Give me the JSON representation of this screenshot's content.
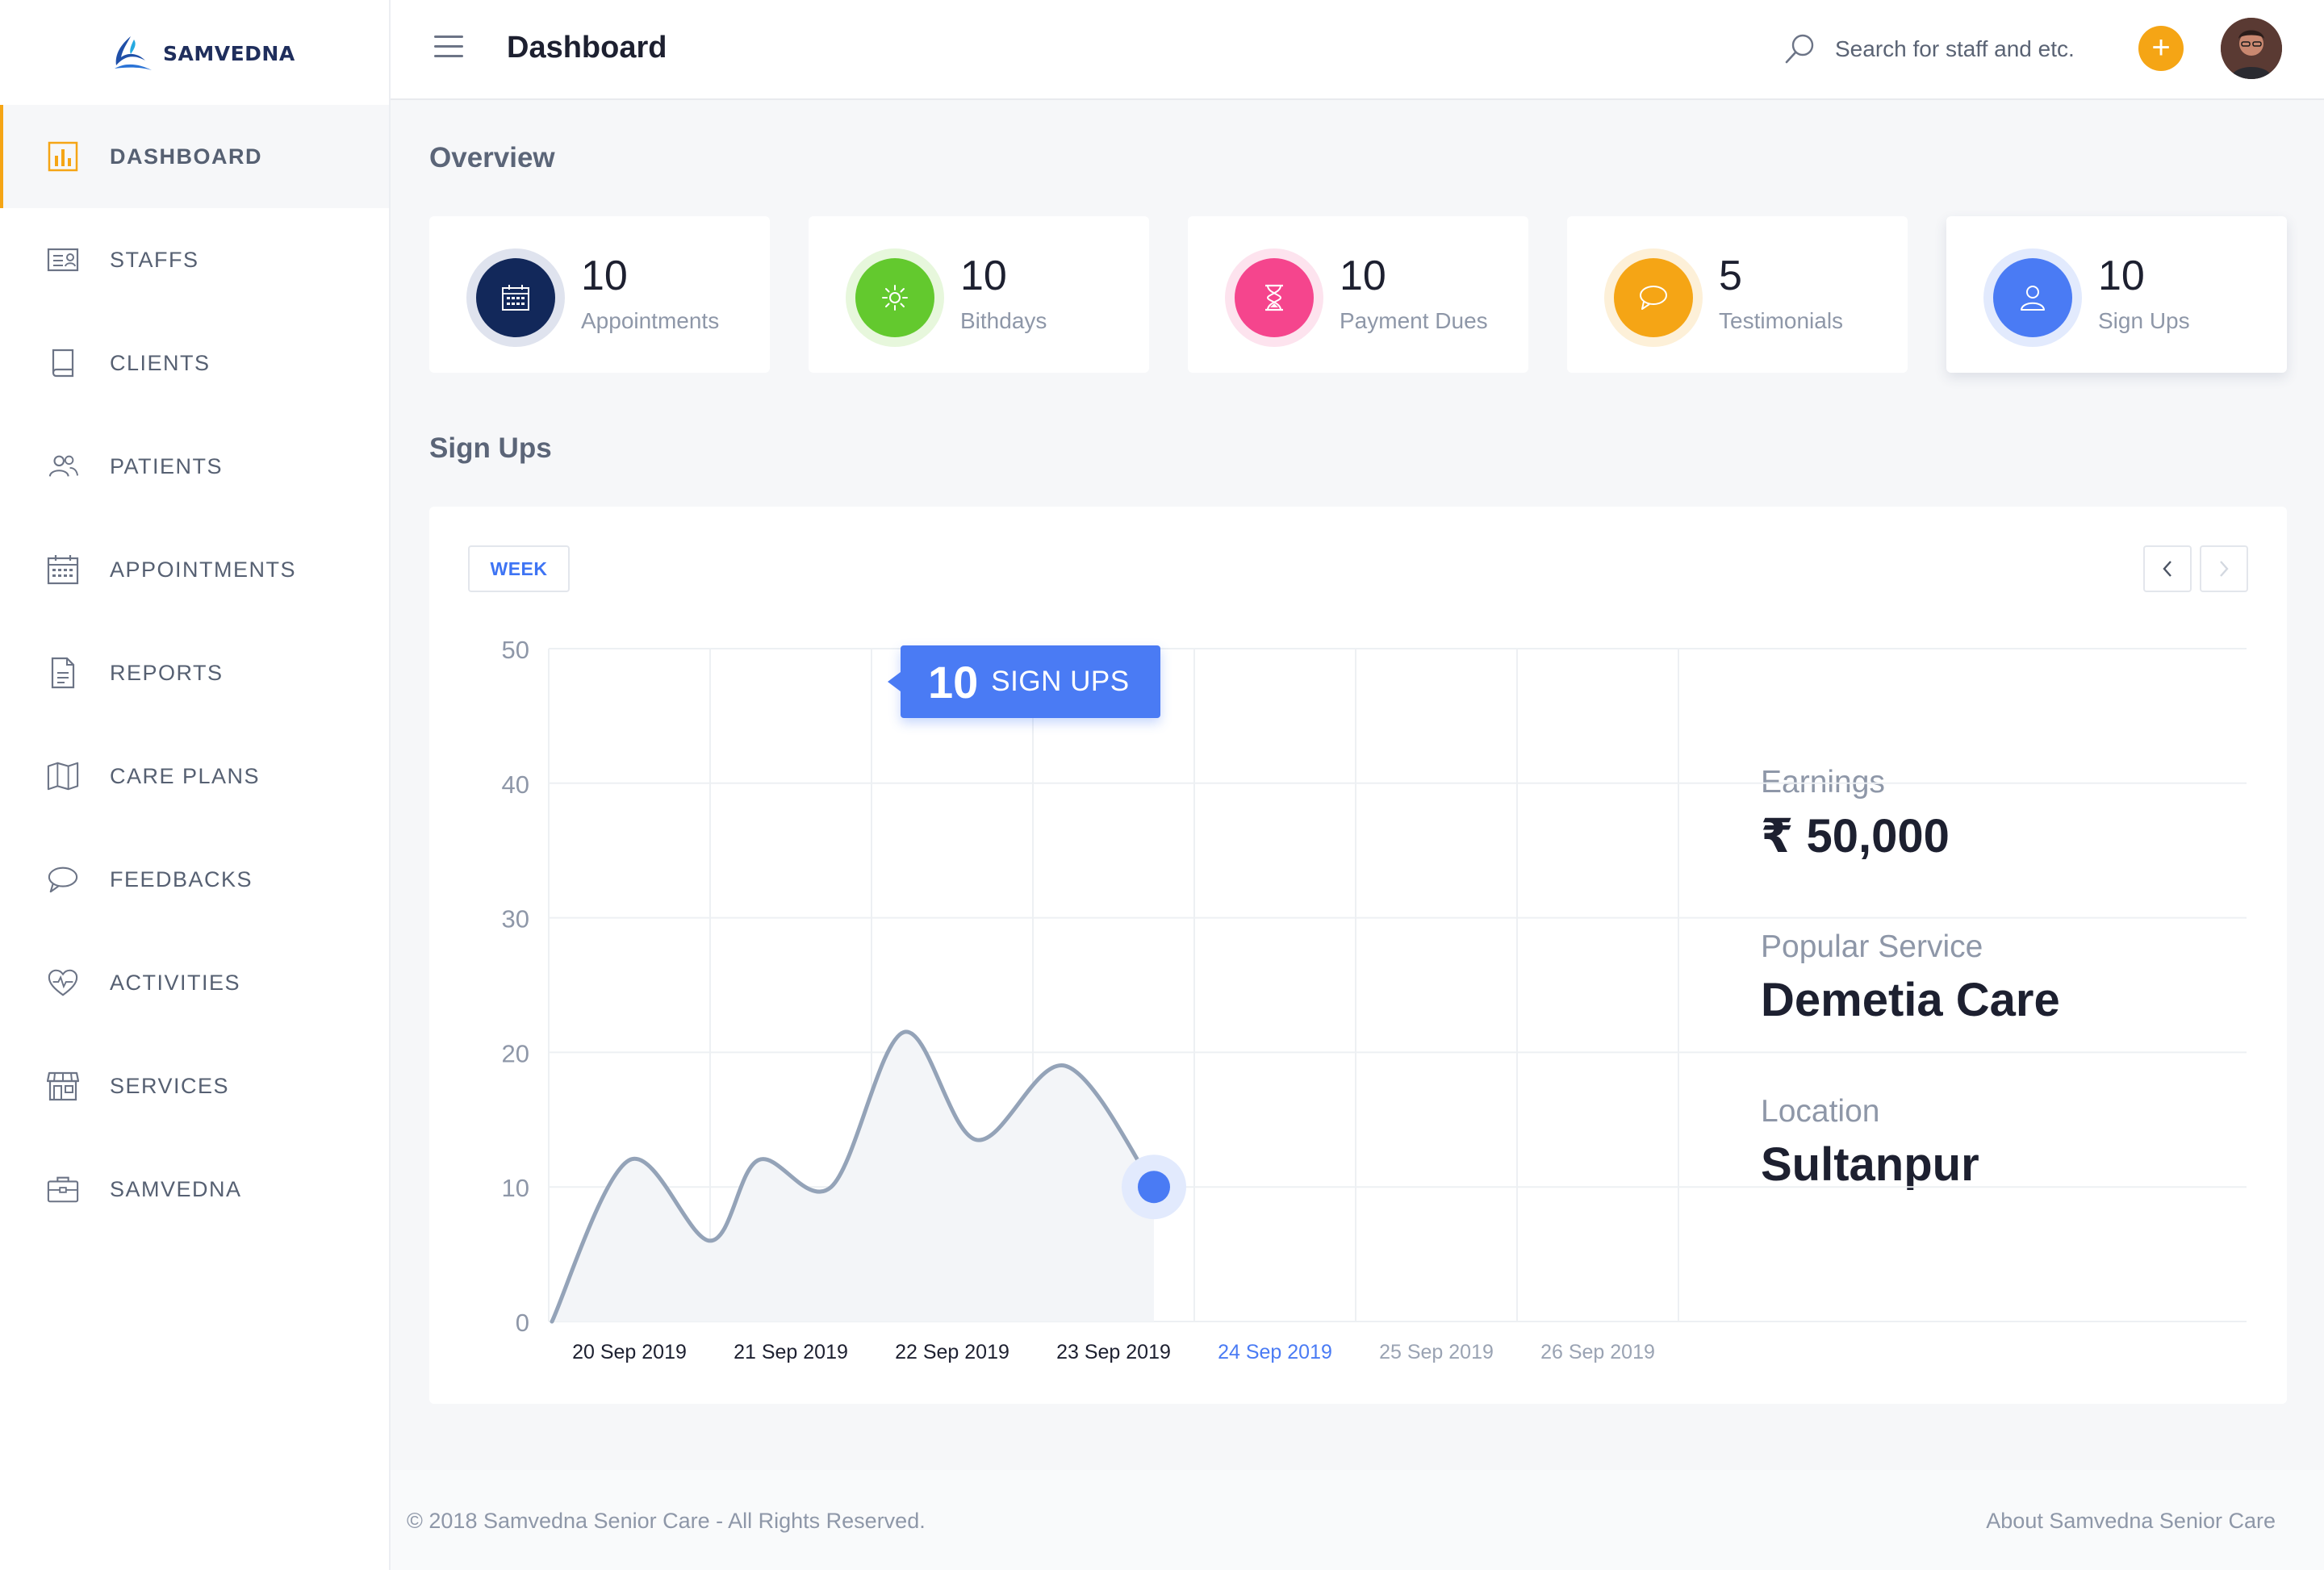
{
  "brand": {
    "name": "SAMVEDNA"
  },
  "header": {
    "title": "Dashboard",
    "search_placeholder": "Search for staff and etc.",
    "add_label": "+"
  },
  "sidebar": {
    "items": [
      {
        "label": "DASHBOARD",
        "icon": "bar-chart-icon",
        "active": true
      },
      {
        "label": "STAFFS",
        "icon": "id-card-icon"
      },
      {
        "label": "CLIENTS",
        "icon": "book-icon"
      },
      {
        "label": "PATIENTS",
        "icon": "users-icon"
      },
      {
        "label": "APPOINTMENTS",
        "icon": "calendar-icon"
      },
      {
        "label": "REPORTS",
        "icon": "document-icon"
      },
      {
        "label": "CARE PLANS",
        "icon": "map-icon"
      },
      {
        "label": "FEEDBACKS",
        "icon": "chat-bubble-icon"
      },
      {
        "label": "ACTIVITIES",
        "icon": "heartbeat-icon"
      },
      {
        "label": "SERVICES",
        "icon": "storefront-icon"
      },
      {
        "label": "SAMVEDNA",
        "icon": "briefcase-icon"
      }
    ]
  },
  "overview": {
    "title": "Overview",
    "cards": [
      {
        "value": "10",
        "label": "Appointments",
        "icon": "calendar-icon",
        "color": "#12285a",
        "ring": "#dfe3ee"
      },
      {
        "value": "10",
        "label": "Bithdays",
        "icon": "sun-icon",
        "color": "#63c92e",
        "ring": "#e7f7dc"
      },
      {
        "value": "10",
        "label": "Payment Dues",
        "icon": "hourglass-icon",
        "color": "#f5458d",
        "ring": "#fde3ee"
      },
      {
        "value": "5",
        "label": "Testimonials",
        "icon": "chat-bubble-icon",
        "color": "#f5a515",
        "ring": "#fdf0d8"
      },
      {
        "value": "10",
        "label": "Sign Ups",
        "icon": "user-icon",
        "color": "#4a7bf4",
        "ring": "#e2eafd"
      }
    ]
  },
  "signups": {
    "title": "Sign Ups",
    "range_button": "WEEK",
    "tooltip": {
      "value": "10",
      "label": "SIGN UPS"
    },
    "summary": {
      "earnings_label": "Earnings",
      "earnings_value": "₹ 50,000",
      "service_label": "Popular Service",
      "service_value": "Demetia Care",
      "location_label": "Location",
      "location_value": "Sultanpur"
    }
  },
  "chart_data": {
    "type": "area",
    "x": [
      "20 Sep 2019",
      "21 Sep 2019",
      "22 Sep 2019",
      "23 Sep 2019",
      "24 Sep 2019",
      "25 Sep 2019",
      "26 Sep 2019"
    ],
    "series": [
      {
        "points": [
          [
            0,
            0
          ],
          [
            0.5,
            12
          ],
          [
            1.0,
            6
          ],
          [
            1.3,
            12
          ],
          [
            1.75,
            10
          ],
          [
            2.2,
            21.5
          ],
          [
            2.65,
            13.5
          ],
          [
            3.2,
            19
          ],
          [
            3.75,
            10
          ]
        ]
      }
    ],
    "highlight": {
      "x": "24 Sep 2019",
      "y": 10
    },
    "ylim": [
      0,
      50
    ],
    "yticks": [
      0,
      10,
      20,
      30,
      40,
      50
    ],
    "grid": true,
    "colors": {
      "line": "#94a3b8",
      "fill": "#f3f5f8",
      "point": "#4a7bf4",
      "current_label": "#4a7bf4",
      "past_label": "#1d2030",
      "future_label": "#9aa3b3"
    }
  },
  "footer": {
    "copyright": "© 2018 Samvedna Senior Care - All Rights Reserved.",
    "about": "About Samvedna Senior Care"
  }
}
